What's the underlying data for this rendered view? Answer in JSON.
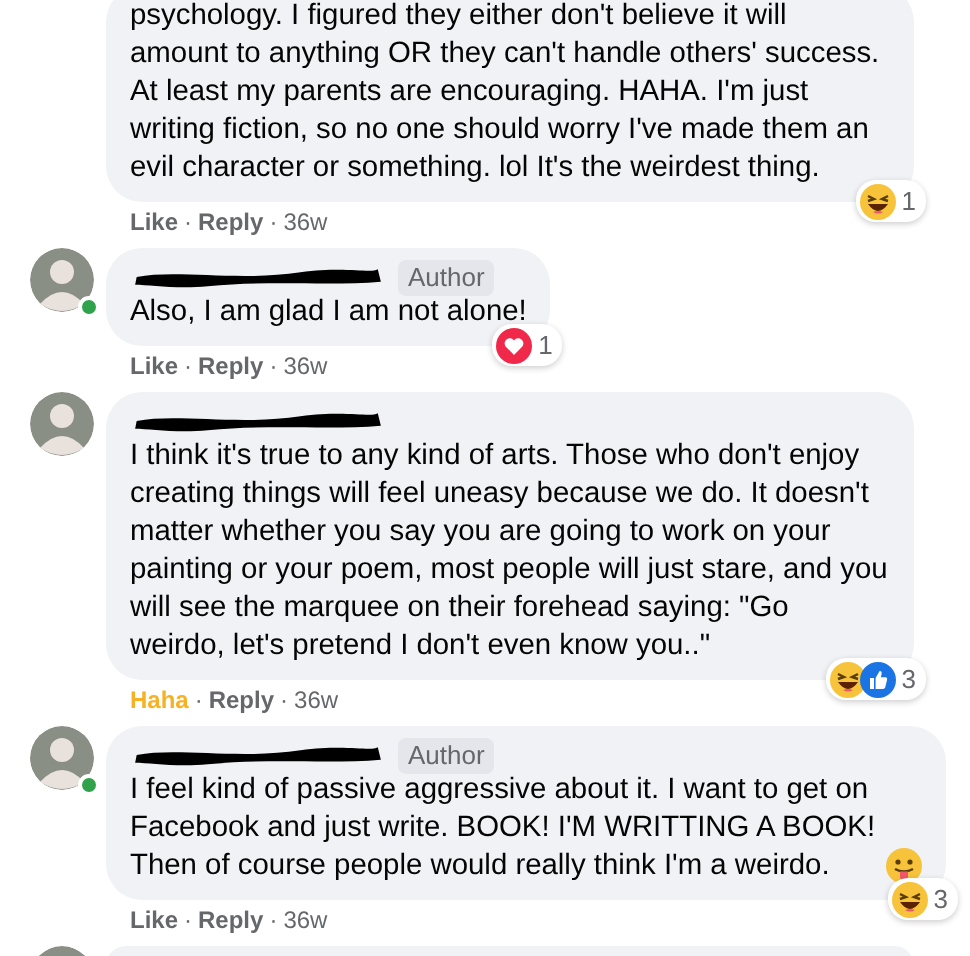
{
  "separator": "·",
  "comments": [
    {
      "kind": "continued",
      "online": false,
      "text": "psychology. I figured they either don't believe it will amount to anything OR they can't handle others' success. At least my parents are encouraging. HAHA. I'm just writing fiction, so no one should worry I've made them an evil character or something. lol It's the weirdest thing.",
      "reactions": [
        {
          "kind": "haha"
        }
      ],
      "reaction_count": "1",
      "like": {
        "label": "Like",
        "active": false
      },
      "reply": "Reply",
      "time": "36w"
    },
    {
      "kind": "full",
      "online": true,
      "badge": "Author",
      "text": "Also, I am glad I am not alone!",
      "reactions": [
        {
          "kind": "love"
        }
      ],
      "reaction_count": "1",
      "like": {
        "label": "Like",
        "active": false
      },
      "reply": "Reply",
      "time": "36w"
    },
    {
      "kind": "full",
      "online": false,
      "text": "I think it's true to any kind of arts. Those who don't enjoy creating things will feel uneasy because we do. It doesn't matter whether you say you are going to work on your painting or your poem, most people will just stare, and you will see the marquee on their forehead saying: \"Go weirdo, let's pretend I don't even know you..\"",
      "reactions": [
        {
          "kind": "haha"
        },
        {
          "kind": "like"
        }
      ],
      "reaction_count": "3",
      "like": {
        "label": "Haha",
        "active": true
      },
      "reply": "Reply",
      "time": "36w"
    },
    {
      "kind": "full",
      "online": true,
      "badge": "Author",
      "text": "I feel kind of passive aggressive about it. I want to get on Facebook and just write. BOOK! I'M WRITTING A BOOK! Then of course people would really think I'm a weirdo.",
      "emoji": {
        "kind": "tongue"
      },
      "reactions": [
        {
          "kind": "haha"
        }
      ],
      "reaction_count": "3",
      "like": {
        "label": "Like",
        "active": false
      },
      "reply": "Reply",
      "time": "36w"
    },
    {
      "kind": "partial"
    }
  ]
}
